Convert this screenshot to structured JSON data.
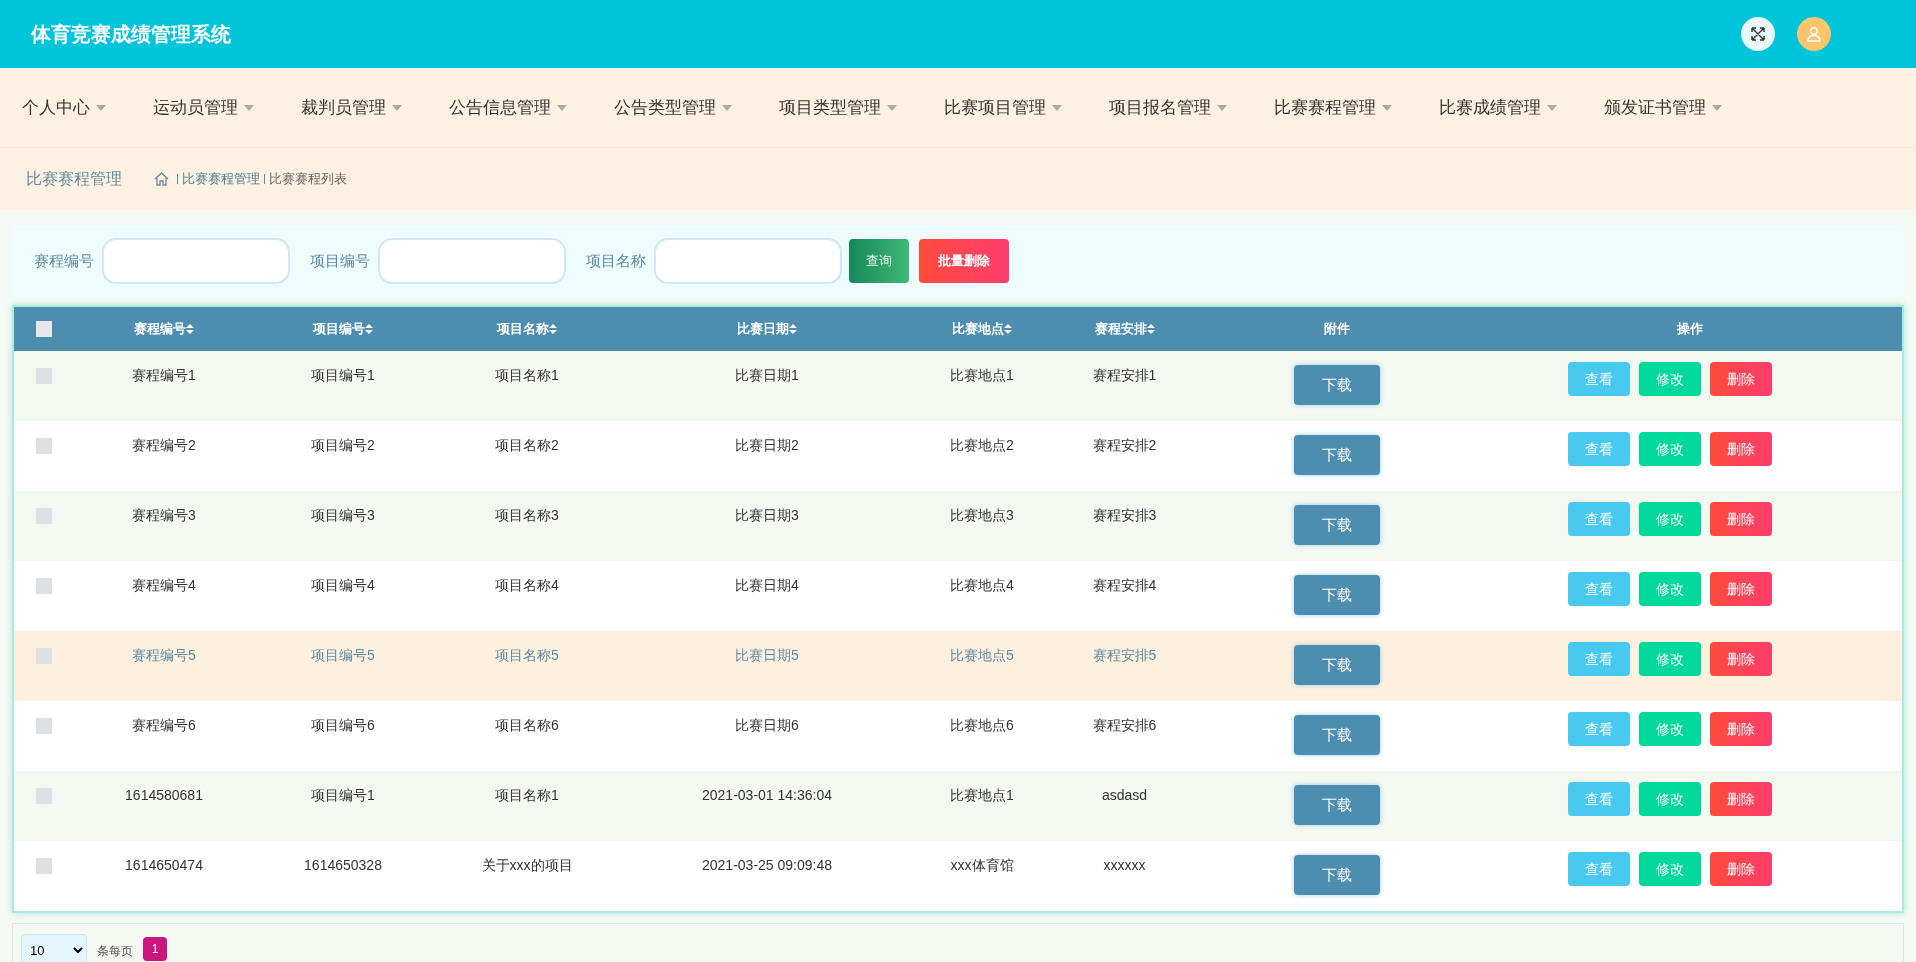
{
  "header": {
    "title": "体育竞赛成绩管理系统"
  },
  "nav": [
    {
      "label": "个人中心"
    },
    {
      "label": "运动员管理"
    },
    {
      "label": "裁判员管理"
    },
    {
      "label": "公告信息管理"
    },
    {
      "label": "公告类型管理"
    },
    {
      "label": "项目类型管理"
    },
    {
      "label": "比赛项目管理"
    },
    {
      "label": "项目报名管理"
    },
    {
      "label": "比赛赛程管理"
    },
    {
      "label": "比赛成绩管理"
    },
    {
      "label": "颁发证书管理"
    }
  ],
  "breadcrumb": {
    "page_title": "比赛赛程管理",
    "trail": [
      "比赛赛程管理",
      "比赛赛程列表"
    ]
  },
  "search": {
    "fields": [
      {
        "label": "赛程编号"
      },
      {
        "label": "项目编号"
      },
      {
        "label": "项目名称"
      }
    ],
    "search_button": "查询",
    "batch_delete_button": "批量删除"
  },
  "table": {
    "select_all_checked": false,
    "columns": [
      {
        "label": "赛程编号",
        "sortable": true
      },
      {
        "label": "项目编号",
        "sortable": true
      },
      {
        "label": "项目名称",
        "sortable": true
      },
      {
        "label": "比赛日期",
        "sortable": true
      },
      {
        "label": "比赛地点",
        "sortable": true
      },
      {
        "label": "赛程安排",
        "sortable": true
      },
      {
        "label": "附件",
        "sortable": false
      },
      {
        "label": "操作",
        "sortable": false
      }
    ],
    "rows": [
      {
        "checked": false,
        "hovered": false,
        "cells": [
          "赛程编号1",
          "项目编号1",
          "项目名称1",
          "比赛日期1",
          "比赛地点1",
          "赛程安排1"
        ],
        "attachment": "下载",
        "actions": [
          {
            "kind": "view",
            "label": "查看"
          },
          {
            "kind": "edit",
            "label": "修改"
          },
          {
            "kind": "delete",
            "label": "删除"
          }
        ]
      },
      {
        "checked": false,
        "hovered": false,
        "cells": [
          "赛程编号2",
          "项目编号2",
          "项目名称2",
          "比赛日期2",
          "比赛地点2",
          "赛程安排2"
        ],
        "attachment": "下载",
        "actions": [
          {
            "kind": "view",
            "label": "查看"
          },
          {
            "kind": "edit",
            "label": "修改"
          },
          {
            "kind": "delete",
            "label": "删除"
          }
        ]
      },
      {
        "checked": false,
        "hovered": false,
        "cells": [
          "赛程编号3",
          "项目编号3",
          "项目名称3",
          "比赛日期3",
          "比赛地点3",
          "赛程安排3"
        ],
        "attachment": "下载",
        "actions": [
          {
            "kind": "view",
            "label": "查看"
          },
          {
            "kind": "edit",
            "label": "修改"
          },
          {
            "kind": "delete",
            "label": "删除"
          }
        ]
      },
      {
        "checked": false,
        "hovered": false,
        "cells": [
          "赛程编号4",
          "项目编号4",
          "项目名称4",
          "比赛日期4",
          "比赛地点4",
          "赛程安排4"
        ],
        "attachment": "下载",
        "actions": [
          {
            "kind": "view",
            "label": "查看"
          },
          {
            "kind": "edit",
            "label": "修改"
          },
          {
            "kind": "delete",
            "label": "删除"
          }
        ]
      },
      {
        "checked": false,
        "hovered": true,
        "cells": [
          "赛程编号5",
          "项目编号5",
          "项目名称5",
          "比赛日期5",
          "比赛地点5",
          "赛程安排5"
        ],
        "attachment": "下载",
        "actions": [
          {
            "kind": "view",
            "label": "查看"
          },
          {
            "kind": "edit",
            "label": "修改"
          },
          {
            "kind": "delete",
            "label": "删除"
          }
        ]
      },
      {
        "checked": false,
        "hovered": false,
        "cells": [
          "赛程编号6",
          "项目编号6",
          "项目名称6",
          "比赛日期6",
          "比赛地点6",
          "赛程安排6"
        ],
        "attachment": "下载",
        "actions": [
          {
            "kind": "view",
            "label": "查看"
          },
          {
            "kind": "edit",
            "label": "修改"
          },
          {
            "kind": "delete",
            "label": "删除"
          }
        ]
      },
      {
        "checked": false,
        "hovered": false,
        "cells": [
          "1614580681",
          "项目编号1",
          "项目名称1",
          "2021-03-01 14:36:04",
          "比赛地点1",
          "asdasd"
        ],
        "attachment": "下载",
        "actions": [
          {
            "kind": "view",
            "label": "查看"
          },
          {
            "kind": "edit",
            "label": "修改"
          },
          {
            "kind": "delete",
            "label": "删除"
          }
        ]
      },
      {
        "checked": false,
        "hovered": false,
        "cells": [
          "1614650474",
          "1614650328",
          "关于xxx的项目",
          "2021-03-25 09:09:48",
          "xxx体育馆",
          "xxxxxx"
        ],
        "attachment": "下载",
        "actions": [
          {
            "kind": "view",
            "label": "查看"
          },
          {
            "kind": "edit",
            "label": "修改"
          },
          {
            "kind": "delete",
            "label": "删除"
          }
        ]
      }
    ]
  },
  "pagination": {
    "page_size": "10",
    "per_page_label": "条每页",
    "pages": [
      {
        "label": "1",
        "selected": true
      }
    ]
  }
}
